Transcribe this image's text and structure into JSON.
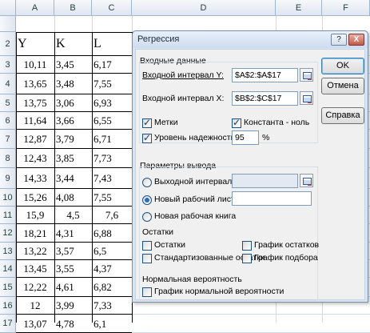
{
  "sheet": {
    "columns": [
      "A",
      "B",
      "C",
      "D",
      "E",
      "F"
    ],
    "rows": [
      "2",
      "3",
      "4",
      "5",
      "6",
      "7",
      "8",
      "9",
      "10",
      "11",
      "12",
      "13",
      "14",
      "15",
      "16",
      "17"
    ],
    "headers": [
      "Y",
      "K",
      "L"
    ],
    "data": [
      [
        "10,11",
        "3,45",
        "6,17"
      ],
      [
        "13,65",
        "3,48",
        "7,55"
      ],
      [
        "13,75",
        "3,06",
        "6,93"
      ],
      [
        "11,64",
        "3,66",
        "6,55"
      ],
      [
        "12,87",
        "3,79",
        "6,71"
      ],
      [
        "12,43",
        "3,85",
        "7,73"
      ],
      [
        "14,33",
        "3,44",
        "7,43"
      ],
      [
        "15,26",
        "4,08",
        "7,55"
      ],
      [
        "15,9",
        "4,5",
        "7,6"
      ],
      [
        "18,21",
        "4,31",
        "6,88"
      ],
      [
        "13,22",
        "3,57",
        "6,5"
      ],
      [
        "13,45",
        "3,55",
        "4,37"
      ],
      [
        "12,22",
        "4,61",
        "6,82"
      ],
      [
        "12",
        "3,99",
        "7,33"
      ],
      [
        "13,07",
        "4,78",
        "6,1"
      ]
    ]
  },
  "dialog": {
    "title": "Регрессия",
    "help_glyph": "?",
    "close_glyph": "X",
    "input_section": "Входные данные",
    "input_y_label": "Входной интервал Y:",
    "input_y_value": "$A$2:$A$17",
    "input_x_label": "Входной интервал X:",
    "input_x_value": "$B$2:$C$17",
    "labels_check": "Метки",
    "constant_check": "Константа - ноль",
    "confidence_check": "Уровень надежности:",
    "confidence_value": "95",
    "percent": "%",
    "output_section": "Параметры вывода",
    "output_range": "Выходной интервал:",
    "new_sheet": "Новый рабочий лист:",
    "new_book": "Новая рабочая книга",
    "residuals_section": "Остатки",
    "residuals": "Остатки",
    "standardized_residuals": "Стандартизованные остатки",
    "residual_plot": "График остатков",
    "line_fit_plot": "График подбора",
    "normal_section": "Нормальная вероятность",
    "normal_plot": "График нормальной вероятности",
    "ok": "OK",
    "cancel": "Отмена",
    "help": "Справка"
  }
}
